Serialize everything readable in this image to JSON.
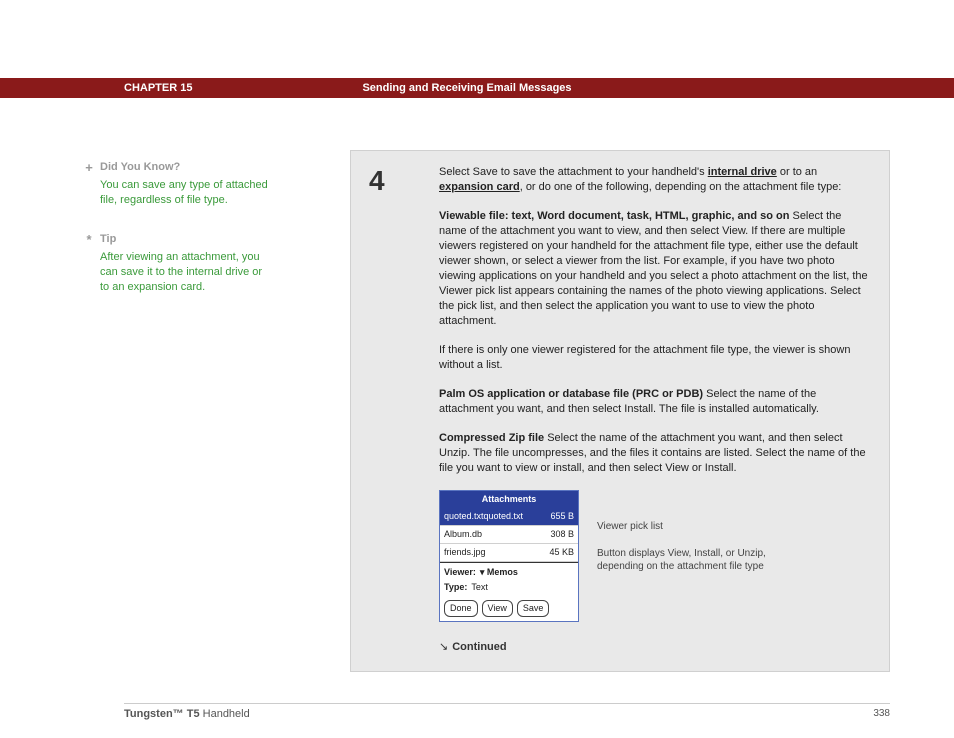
{
  "header": {
    "chapter": "CHAPTER 15",
    "title": "Sending and Receiving Email Messages"
  },
  "sidebar": {
    "dyk": {
      "icon": "+",
      "title": "Did You Know?",
      "text": "You can save any type of attached file, regardless of file type."
    },
    "tip": {
      "icon": "*",
      "title": "Tip",
      "text": "After viewing an attachment, you can save it to the internal drive or to an expansion card."
    }
  },
  "step": {
    "num": "4",
    "p1a": "Select Save to save the attachment to your handheld's ",
    "p1_link1": "internal drive",
    "p1b": " or to an ",
    "p1_link2": "expansion card",
    "p1c": ", or do one of the following, depending on the attachment file type:",
    "p2_label": "Viewable file: text, Word document, task, HTML, graphic, and so on",
    "p2_text": "   Select the name of the attachment you want to view, and then select View. If there are multiple viewers registered on your handheld for the attachment file type, either use the default viewer shown, or select a viewer from the list. For example, if you have two photo viewing applications on your handheld and you select a photo attachment on the list, the Viewer pick list appears containing the names of the photo viewing applications. Select the pick list, and then select the application you want to use to view the photo attachment.",
    "p3": "If there is only one viewer registered for the attachment file type, the viewer is shown without a list.",
    "p4_label": "Palm OS application or database file (PRC or PDB)",
    "p4_text": "   Select the name of the attachment you want, and then select Install. The file is installed automatically.",
    "p5_label": "Compressed Zip file",
    "p5_text": "   Select the name of the attachment you want, and then select Unzip. The file uncompresses, and the files it contains are listed. Select the name of the file you want to view or install, and then select View or Install."
  },
  "device": {
    "title": "Attachments",
    "rows": [
      {
        "name": "quoted.txtquoted.txt",
        "size": "655 B",
        "sel": true
      },
      {
        "name": "Album.db",
        "size": "308 B",
        "sel": false
      },
      {
        "name": "friends.jpg",
        "size": "45 KB",
        "sel": false
      }
    ],
    "viewer_label": "Viewer:",
    "viewer_value": "▾ Memos",
    "type_label": "Type:",
    "type_value": "Text",
    "btn_done": "Done",
    "btn_view": "View",
    "btn_save": "Save"
  },
  "annotations": {
    "a1": "Viewer pick list",
    "a2": "Button displays View, Install, or Unzip, depending on the attachment file type"
  },
  "continued": "Continued",
  "footer": {
    "product_bold": "Tungsten™ T5",
    "product_rest": " Handheld",
    "page": "338"
  }
}
